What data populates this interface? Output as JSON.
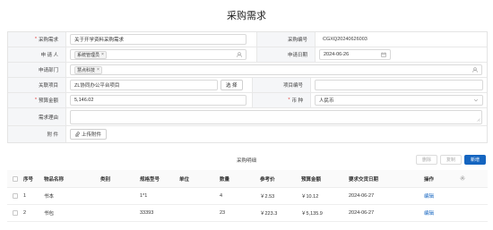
{
  "page": {
    "title": "采购需求"
  },
  "form": {
    "req_mark": "*",
    "purchase_req": {
      "label": "采购需求",
      "value": "关于开学资料采购需求"
    },
    "purchase_no": {
      "label": "采购编号",
      "value": "CGXQ20240626003"
    },
    "applicant": {
      "label": "申 请 人",
      "tag": "系统管理员",
      "tag_close": "×"
    },
    "apply_date": {
      "label": "申请日期",
      "value": "2024-06-26"
    },
    "apply_dept": {
      "label": "申请部门",
      "tag": "慧点科技",
      "tag_close": "×"
    },
    "project": {
      "label": "关联项目",
      "value": "ZL协同办公平台项目",
      "select_label": "选 择"
    },
    "project_no": {
      "label": "项目编号",
      "value": ""
    },
    "budget": {
      "label": "预算金额",
      "value": "5,146.02"
    },
    "currency": {
      "label": "币 种",
      "value": "人民币"
    },
    "reason": {
      "label": "需求理由",
      "value": ""
    },
    "attachment": {
      "label": "附 件",
      "button": "上传附件"
    }
  },
  "details": {
    "title": "采购明细",
    "actions": {
      "delete": "删除",
      "copy": "复制",
      "add": "新增"
    },
    "columns": [
      "序号",
      "物品名称",
      "类别",
      "规格型号",
      "单位",
      "数量",
      "参考价",
      "预算金额",
      "要求交货日期",
      "操作"
    ],
    "rows": [
      {
        "no": "1",
        "name": "书本",
        "category": "",
        "spec": "1*1",
        "unit": "",
        "qty": "4",
        "price": "￥2.53",
        "budget": "￥10.12",
        "date": "2024-06-27",
        "op": "编辑"
      },
      {
        "no": "2",
        "name": "书包",
        "category": "",
        "spec": "33393",
        "unit": "",
        "qty": "23",
        "price": "￥223.3",
        "budget": "￥5,135.9",
        "date": "2024-06-27",
        "op": "编辑"
      }
    ]
  },
  "icons": {
    "user_picker": "user-icon",
    "calendar": "calendar-icon",
    "dept_picker": "org-icon",
    "dropdown": "chevron-down-icon",
    "paperclip": "paperclip-icon",
    "settings": "gear-icon",
    "resize": "resize-handle-icon"
  },
  "colors": {
    "primary": "#1565c0",
    "required": "#e53935",
    "label_bg": "#f5f6f8"
  }
}
